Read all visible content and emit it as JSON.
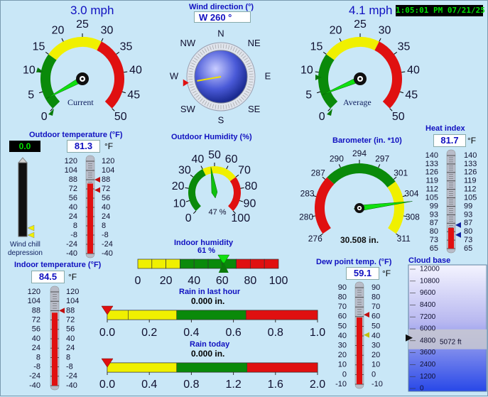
{
  "clock": "1:05:01 PM 07/21/25",
  "wind_current": {
    "speed_text": "3.0 mph",
    "label": "Current",
    "value": 3.0,
    "max": 50,
    "ticks": [
      "0",
      "5",
      "10",
      "15",
      "20",
      "25",
      "30",
      "35",
      "40",
      "45",
      "50"
    ]
  },
  "wind_average": {
    "speed_text": "4.1 mph",
    "label": "Average",
    "value": 4.1,
    "max": 50,
    "ticks": [
      "0",
      "5",
      "10",
      "15",
      "20",
      "25",
      "30",
      "35",
      "40",
      "45",
      "50"
    ]
  },
  "wind_direction": {
    "title": "Wind direction (°)",
    "value_text": "W  260 °",
    "degrees": 260,
    "labels": {
      "n": "N",
      "ne": "NE",
      "e": "E",
      "se": "SE",
      "s": "S",
      "sw": "SW",
      "w": "W",
      "nw": "NW"
    }
  },
  "outdoor_temp": {
    "title": "Outdoor temperature (°F)",
    "value": "81.3",
    "unit": "°F",
    "reading": 81.3,
    "scale": [
      "120",
      "104",
      "88",
      "72",
      "56",
      "40",
      "24",
      "8",
      "-8",
      "-24",
      "-40"
    ]
  },
  "wind_chill": {
    "value": "0.0",
    "label_line1": "Wind chill",
    "label_line2": "depression"
  },
  "outdoor_humidity": {
    "title": "Outdoor Humidity (%)",
    "value_text": "47 %",
    "reading": 47,
    "ticks": [
      "0",
      "10",
      "20",
      "30",
      "40",
      "50",
      "60",
      "70",
      "80",
      "90",
      "100"
    ]
  },
  "barometer": {
    "title": "Barometer (in. *10)",
    "value_text": "30.508 in.",
    "reading": 305.08,
    "ticks": [
      "276",
      "280",
      "283",
      "287",
      "290",
      "294",
      "297",
      "301",
      "304",
      "308",
      "311"
    ]
  },
  "heat_index": {
    "title": "Heat index",
    "value": "81.7",
    "unit": "°F",
    "reading": 81.7,
    "scale": [
      "140",
      "133",
      "126",
      "119",
      "112",
      "105",
      "99",
      "93",
      "87",
      "80",
      "73",
      "65"
    ]
  },
  "indoor_humidity": {
    "title": "Indoor humidity",
    "value_text": "61 %",
    "reading": 61,
    "ticks": [
      "0",
      "20",
      "40",
      "60",
      "80",
      "100"
    ]
  },
  "indoor_temp": {
    "title": "Indoor temperature (°F)",
    "value": "84.5",
    "unit": "°F",
    "reading": 84.5,
    "scale": [
      "120",
      "104",
      "88",
      "72",
      "56",
      "40",
      "24",
      "8",
      "-8",
      "-24",
      "-40"
    ]
  },
  "rain_hour": {
    "title": "Rain in last hour",
    "value_text": "0.000 in.",
    "reading": 0,
    "ticks": [
      "0.0",
      "0.2",
      "0.4",
      "0.6",
      "0.8",
      "1.0"
    ]
  },
  "rain_today": {
    "title": "Rain today",
    "value_text": "0.000 in.",
    "reading": 0,
    "ticks": [
      "0.0",
      "0.4",
      "0.8",
      "1.2",
      "1.6",
      "2.0"
    ]
  },
  "dew_point": {
    "title": "Dew point temp. (°F)",
    "value": "59.1",
    "unit": "°F",
    "reading": 59.1,
    "scale": [
      "90",
      "80",
      "70",
      "60",
      "50",
      "40",
      "30",
      "20",
      "10",
      "0",
      "-10"
    ]
  },
  "cloud_base": {
    "title": "Cloud base",
    "value_text": "5072 ft",
    "reading": 5072,
    "scale": [
      "12000",
      "10800",
      "9600",
      "8400",
      "7200",
      "6000",
      "4800",
      "3600",
      "2400",
      "1200",
      "0"
    ]
  },
  "colors": {
    "green": "#0a8a0a",
    "yellow": "#f0f000",
    "red": "#e01010",
    "text_blue": "#1010c0",
    "bg": "#c9e7f7"
  }
}
